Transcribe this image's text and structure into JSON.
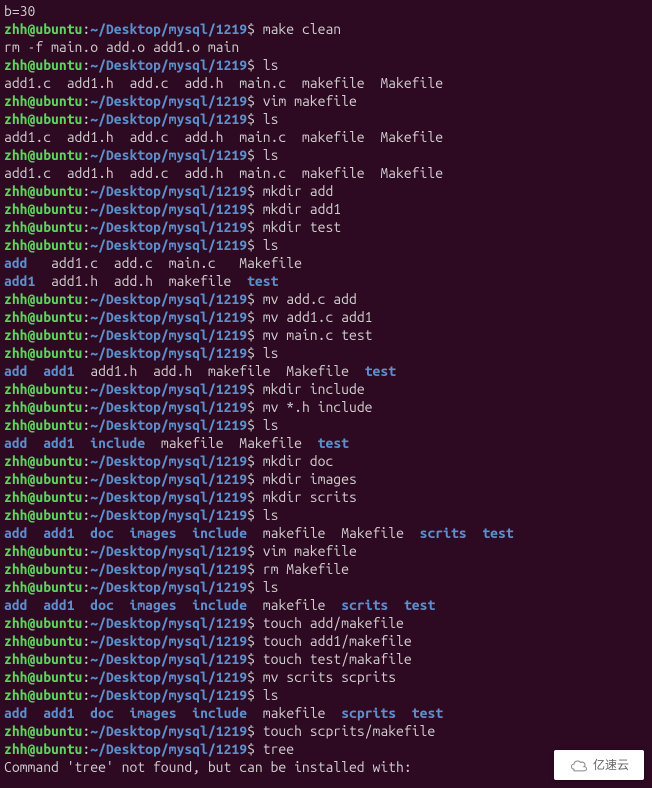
{
  "prompt": {
    "user": "zhh@ubuntu",
    "sep1": ":",
    "path": "~/Desktop/mysql/1219",
    "sep2": "$ "
  },
  "top_output": "b=30",
  "lines": [
    {
      "type": "prompt",
      "cmd": "make clean"
    },
    {
      "type": "output",
      "text": "rm -f main.o add.o add1.o main"
    },
    {
      "type": "prompt",
      "cmd": "ls"
    },
    {
      "type": "output",
      "text": "add1.c  add1.h  add.c  add.h  main.c  makefile  Makefile"
    },
    {
      "type": "prompt",
      "cmd": "vim makefile"
    },
    {
      "type": "prompt",
      "cmd": "ls"
    },
    {
      "type": "output",
      "text": "add1.c  add1.h  add.c  add.h  main.c  makefile  Makefile"
    },
    {
      "type": "prompt",
      "cmd": "ls"
    },
    {
      "type": "output",
      "text": "add1.c  add1.h  add.c  add.h  main.c  makefile  Makefile"
    },
    {
      "type": "prompt",
      "cmd": "mkdir add"
    },
    {
      "type": "prompt",
      "cmd": "mkdir add1"
    },
    {
      "type": "prompt",
      "cmd": "mkdir test"
    },
    {
      "type": "prompt",
      "cmd": "ls"
    },
    {
      "type": "ls",
      "items": [
        {
          "t": "add",
          "d": true
        },
        {
          "t": "   add1.c  add.c  main.c   Makefile",
          "d": false
        }
      ]
    },
    {
      "type": "ls",
      "items": [
        {
          "t": "add1",
          "d": true
        },
        {
          "t": "  add1.h  add.h  makefile  ",
          "d": false
        },
        {
          "t": "test",
          "d": true
        }
      ]
    },
    {
      "type": "prompt",
      "cmd": "mv add.c add"
    },
    {
      "type": "prompt",
      "cmd": "mv add1.c add1"
    },
    {
      "type": "prompt",
      "cmd": "mv main.c test"
    },
    {
      "type": "prompt",
      "cmd": "ls"
    },
    {
      "type": "ls",
      "items": [
        {
          "t": "add",
          "d": true
        },
        {
          "t": "  ",
          "d": false
        },
        {
          "t": "add1",
          "d": true
        },
        {
          "t": "  add1.h  add.h  makefile  Makefile  ",
          "d": false
        },
        {
          "t": "test",
          "d": true
        }
      ]
    },
    {
      "type": "prompt",
      "cmd": "mkdir include"
    },
    {
      "type": "prompt",
      "cmd": "mv *.h include"
    },
    {
      "type": "prompt",
      "cmd": "ls"
    },
    {
      "type": "ls",
      "items": [
        {
          "t": "add",
          "d": true
        },
        {
          "t": "  ",
          "d": false
        },
        {
          "t": "add1",
          "d": true
        },
        {
          "t": "  ",
          "d": false
        },
        {
          "t": "include",
          "d": true
        },
        {
          "t": "  makefile  Makefile  ",
          "d": false
        },
        {
          "t": "test",
          "d": true
        }
      ]
    },
    {
      "type": "prompt",
      "cmd": "mkdir doc"
    },
    {
      "type": "prompt",
      "cmd": "mkdir images"
    },
    {
      "type": "prompt",
      "cmd": "mkdir scrits"
    },
    {
      "type": "prompt",
      "cmd": "ls"
    },
    {
      "type": "ls",
      "items": [
        {
          "t": "add",
          "d": true
        },
        {
          "t": "  ",
          "d": false
        },
        {
          "t": "add1",
          "d": true
        },
        {
          "t": "  ",
          "d": false
        },
        {
          "t": "doc",
          "d": true
        },
        {
          "t": "  ",
          "d": false
        },
        {
          "t": "images",
          "d": true
        },
        {
          "t": "  ",
          "d": false
        },
        {
          "t": "include",
          "d": true
        },
        {
          "t": "  makefile  Makefile  ",
          "d": false
        },
        {
          "t": "scrits",
          "d": true
        },
        {
          "t": "  ",
          "d": false
        },
        {
          "t": "test",
          "d": true
        }
      ]
    },
    {
      "type": "prompt",
      "cmd": "vim makefile"
    },
    {
      "type": "prompt",
      "cmd": "rm Makefile"
    },
    {
      "type": "prompt",
      "cmd": "ls"
    },
    {
      "type": "ls",
      "items": [
        {
          "t": "add",
          "d": true
        },
        {
          "t": "  ",
          "d": false
        },
        {
          "t": "add1",
          "d": true
        },
        {
          "t": "  ",
          "d": false
        },
        {
          "t": "doc",
          "d": true
        },
        {
          "t": "  ",
          "d": false
        },
        {
          "t": "images",
          "d": true
        },
        {
          "t": "  ",
          "d": false
        },
        {
          "t": "include",
          "d": true
        },
        {
          "t": "  makefile  ",
          "d": false
        },
        {
          "t": "scrits",
          "d": true
        },
        {
          "t": "  ",
          "d": false
        },
        {
          "t": "test",
          "d": true
        }
      ]
    },
    {
      "type": "prompt",
      "cmd": "touch add/makefile"
    },
    {
      "type": "prompt",
      "cmd": "touch add1/makefile"
    },
    {
      "type": "prompt",
      "cmd": "touch test/makafile"
    },
    {
      "type": "prompt",
      "cmd": "mv scrits scprits"
    },
    {
      "type": "prompt",
      "cmd": "ls"
    },
    {
      "type": "ls",
      "items": [
        {
          "t": "add",
          "d": true
        },
        {
          "t": "  ",
          "d": false
        },
        {
          "t": "add1",
          "d": true
        },
        {
          "t": "  ",
          "d": false
        },
        {
          "t": "doc",
          "d": true
        },
        {
          "t": "  ",
          "d": false
        },
        {
          "t": "images",
          "d": true
        },
        {
          "t": "  ",
          "d": false
        },
        {
          "t": "include",
          "d": true
        },
        {
          "t": "  makefile  ",
          "d": false
        },
        {
          "t": "scprits",
          "d": true
        },
        {
          "t": "  ",
          "d": false
        },
        {
          "t": "test",
          "d": true
        }
      ]
    },
    {
      "type": "prompt",
      "cmd": "touch scprits/makefile"
    },
    {
      "type": "prompt",
      "cmd": "tree"
    },
    {
      "type": "output",
      "text": ""
    },
    {
      "type": "output",
      "text": "Command 'tree' not found, but can be installed with:"
    }
  ],
  "watermark": "亿速云"
}
